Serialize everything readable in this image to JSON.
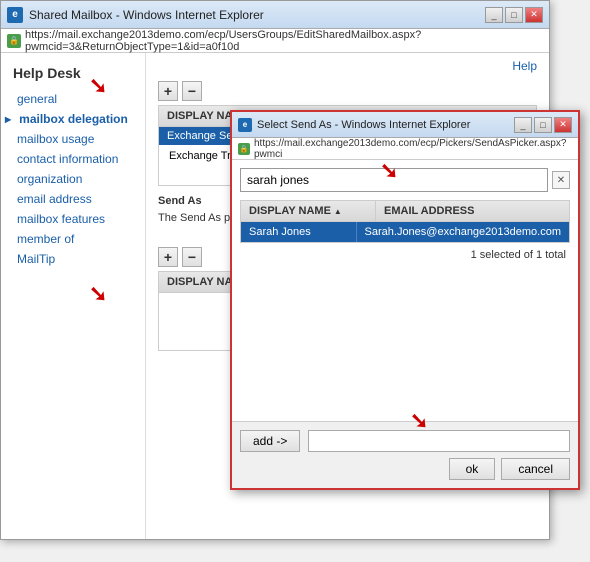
{
  "mainWindow": {
    "title": "Shared Mailbox - Windows Internet Explorer",
    "addressBar": "https://mail.exchange2013demo.com/ecp/UsersGroups/EditSharedMailbox.aspx?pwmcid=3&ReturnObjectType=1&id=a0f10d",
    "helpLink": "Help"
  },
  "sidebar": {
    "title": "Help Desk",
    "items": [
      {
        "label": "general",
        "active": false
      },
      {
        "label": "mailbox delegation",
        "active": true
      },
      {
        "label": "mailbox usage",
        "active": false
      },
      {
        "label": "contact information",
        "active": false
      },
      {
        "label": "organization",
        "active": false
      },
      {
        "label": "email address",
        "active": false
      },
      {
        "label": "mailbox features",
        "active": false
      },
      {
        "label": "member of",
        "active": false
      },
      {
        "label": "MailTip",
        "active": false
      }
    ]
  },
  "mainPanel": {
    "section1": {
      "displayNameHeader": "DISPLAY NAME",
      "selectedRow": "Exchange Servers",
      "bodyRow": "Exchange Trusted Su..."
    },
    "sendAsDesc": {
      "title": "Send As",
      "body": "The Send As permissio email from this shared perspective, the email"
    },
    "section2": {
      "displayNameHeader": "DISPLAY NAME"
    }
  },
  "popup": {
    "title": "Select Send As - Windows Internet Explorer",
    "addressBar": "https://mail.exchange2013demo.com/ecp/Pickers/SendAsPicker.aspx?pwmci",
    "searchValue": "sarah jones",
    "searchPlaceholder": "",
    "table": {
      "colName": "DISPLAY NAME",
      "colEmail": "EMAIL ADDRESS",
      "row": {
        "name": "Sarah Jones",
        "email": "Sarah.Jones@exchange2013demo.com"
      }
    },
    "statusText": "1 selected of 1 total",
    "addButton": "add ->",
    "okButton": "ok",
    "cancelButton": "cancel"
  },
  "arrows": [
    {
      "id": "arrow1",
      "label": "↘"
    },
    {
      "id": "arrow2",
      "label": "↘"
    },
    {
      "id": "arrow3",
      "label": "↙"
    }
  ]
}
